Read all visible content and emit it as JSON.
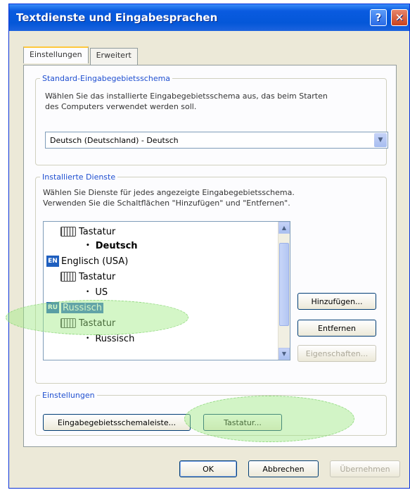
{
  "window": {
    "title": "Textdienste und Eingabesprachen",
    "help_label": "?",
    "close_label": "✕"
  },
  "tabs": [
    {
      "label": "Einstellungen",
      "active": true
    },
    {
      "label": "Erweitert",
      "active": false
    }
  ],
  "default_group": {
    "legend": "Standard-Eingabegebietsschema",
    "description_line1": "Wählen Sie das installierte Eingabegebietsschema aus, das beim Starten",
    "description_line2": "des Computers verwendet werden soll.",
    "combo_value": "Deutsch (Deutschland) - Deutsch"
  },
  "installed_group": {
    "legend": "Installierte Dienste",
    "description_line1": "Wählen Sie Dienste für jedes angezeigte Eingabegebietsschema.",
    "description_line2": "Verwenden Sie die Schaltflächen \"Hinzufügen\" und \"Entfernen\".",
    "tree": [
      {
        "type": "keyboard",
        "label": "Tastatur"
      },
      {
        "type": "layout",
        "label": "Deutsch"
      },
      {
        "type": "language",
        "code": "EN",
        "label": "Englisch (USA)"
      },
      {
        "type": "keyboard",
        "label": "Tastatur"
      },
      {
        "type": "layout",
        "label": "US"
      },
      {
        "type": "language",
        "code": "RU",
        "label": "Russisch"
      },
      {
        "type": "keyboard",
        "label": "Tastatur"
      },
      {
        "type": "layout",
        "label": "Russisch"
      }
    ],
    "buttons": {
      "add": "Hinzufügen...",
      "remove": "Entfernen",
      "properties": "Eigenschaften..."
    }
  },
  "settings_group": {
    "legend": "Einstellungen",
    "language_bar_button": "Eingabegebietsschemaleiste...",
    "keyboard_button": "Tastatur..."
  },
  "footer": {
    "ok": "OK",
    "cancel": "Abbrechen",
    "apply": "Übernehmen"
  },
  "colors": {
    "title_bar": "#0457d8",
    "selection": "#316ac5",
    "highlight": "#a0eb82"
  }
}
